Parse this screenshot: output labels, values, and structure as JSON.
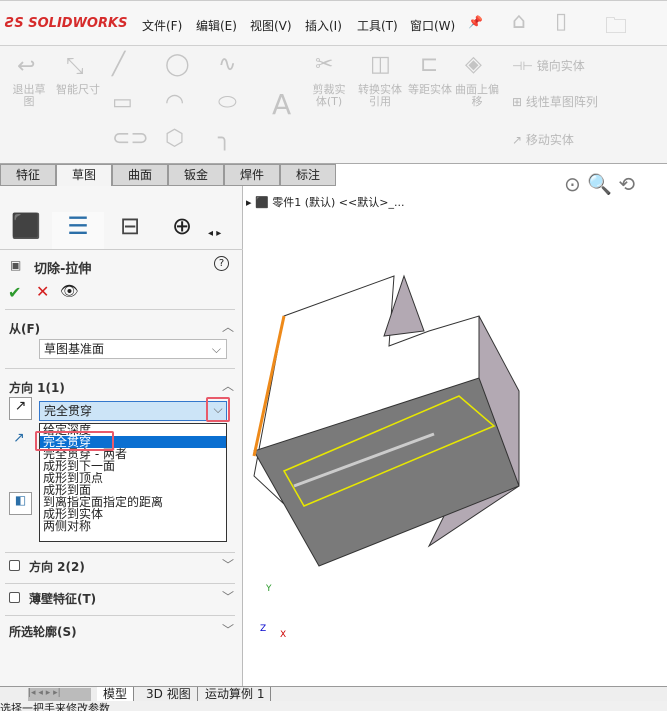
{
  "app": {
    "logo": "SOLIDWORKS"
  },
  "menu": [
    "文件(F)",
    "编辑(E)",
    "视图(V)",
    "插入(I)",
    "工具(T)",
    "窗口(W)"
  ],
  "ribbon": {
    "exit_sketch": "退出草图",
    "smart_dim": "智能尺寸",
    "trim": "剪裁实体(T)",
    "convert": "转换实体引用",
    "offset": "等距实体",
    "surface_offset": "曲面上偏移",
    "mirror": "镜向实体",
    "linear_pattern": "线性草图阵列",
    "move": "移动实体"
  },
  "tabs": [
    {
      "label": "特征"
    },
    {
      "label": "草图",
      "active": true
    },
    {
      "label": "曲面"
    },
    {
      "label": "钣金"
    },
    {
      "label": "焊件"
    },
    {
      "label": "标注"
    }
  ],
  "panel": {
    "title": "切除-拉伸",
    "from": {
      "label": "从(F)",
      "value": "草图基准面"
    },
    "direction1": {
      "label": "方向 1(1)",
      "value": "完全贯穿",
      "options": [
        "给定深度",
        "完全贯穿",
        "完全贯穿 - 两者",
        "成形到下一面",
        "成形到顶点",
        "成形到面",
        "到离指定面指定的距离",
        "成形到实体",
        "两侧对称"
      ],
      "selected_index": 1
    },
    "direction2": {
      "label": "方向 2(2)",
      "checked": false
    },
    "thin": {
      "label": "薄壁特征(T)",
      "checked": false
    },
    "contours": {
      "label": "所选轮廓(S)"
    }
  },
  "viewport": {
    "tree_label": "零件1 (默认) <<默认>_..."
  },
  "triad": {
    "x": "X",
    "y": "Y",
    "z": "Z"
  },
  "bottom_tabs": [
    "模型",
    "3D 视图",
    "运动算例 1"
  ],
  "status": "选择一把手来修改参数",
  "colors": {
    "highlight": "#e85a6a",
    "selected": "#0a6fd1",
    "brand": "#d62b2b"
  }
}
